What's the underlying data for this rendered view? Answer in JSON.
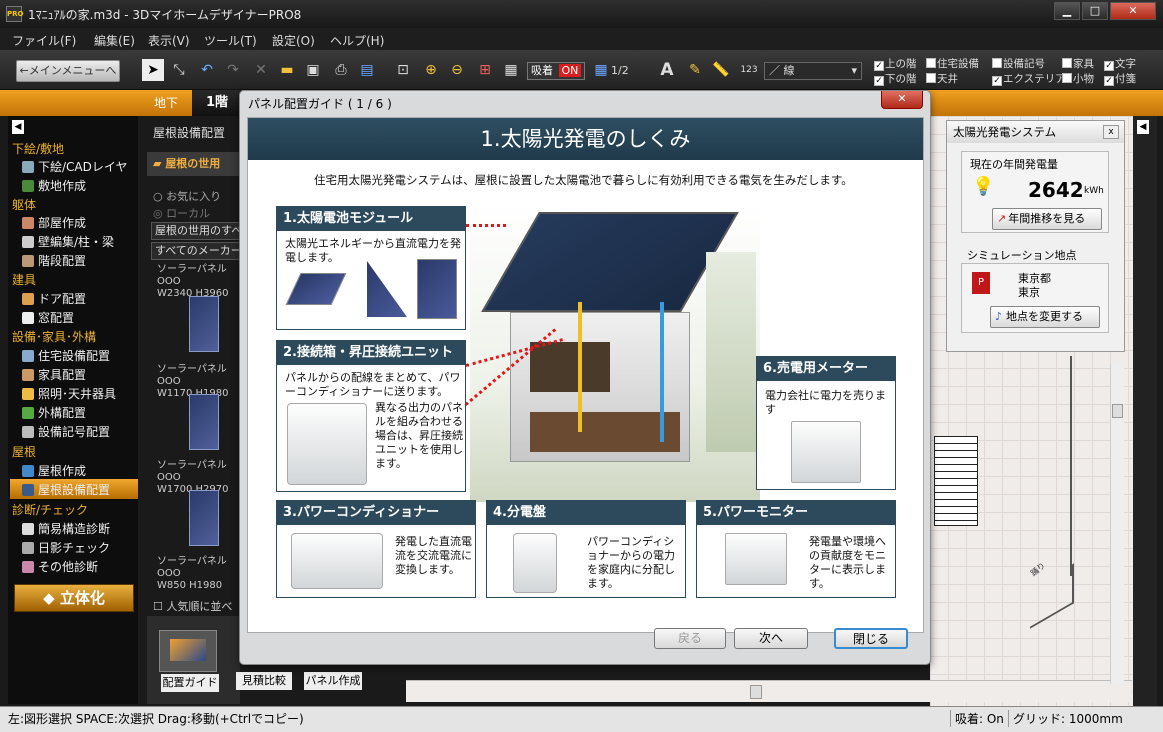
{
  "window": {
    "title": "1ﾏﾆｭｱﾙの家.m3d - 3DマイホームデザイナーPRO8",
    "logo": "PRO"
  },
  "menu": [
    "ファイル(F)",
    "編集(E)",
    "表示(V)",
    "ツール(T)",
    "設定(O)",
    "ヘルプ(H)"
  ],
  "toolbar": {
    "main_menu": "←メインメニューへ",
    "snap_label": "吸着",
    "snap_state": "ON",
    "page": "1/2",
    "line_label": "線",
    "checks": [
      {
        "label": "上の階",
        "on": true
      },
      {
        "label": "住宅設備",
        "on": false
      },
      {
        "label": "設備記号",
        "on": false
      },
      {
        "label": "家具",
        "on": false
      },
      {
        "label": "文字",
        "on": true
      },
      {
        "label": "下の階",
        "on": true
      },
      {
        "label": "天井",
        "on": false
      },
      {
        "label": "エクステリア",
        "on": true
      },
      {
        "label": "小物",
        "on": false
      },
      {
        "label": "付箋",
        "on": true
      }
    ]
  },
  "floor_tabs": [
    "地下",
    "1階"
  ],
  "nav": {
    "sections": [
      {
        "title": "下絵/敷地",
        "items": [
          "下絵/CADレイヤ",
          "敷地作成"
        ]
      },
      {
        "title": "躯体",
        "items": [
          "部屋作成",
          "壁編集/柱・梁",
          "階段配置"
        ]
      },
      {
        "title": "建具",
        "items": [
          "ドア配置",
          "窓配置"
        ]
      },
      {
        "title": "設備･家具･外構",
        "items": [
          "住宅設備配置",
          "家具配置",
          "照明･天井器具",
          "外構配置",
          "設備記号配置"
        ]
      },
      {
        "title": "屋根",
        "items": [
          "屋根作成",
          "屋根設備配置"
        ]
      },
      {
        "title": "診断/チェック",
        "items": [
          "簡易構造診断",
          "日影チェック",
          "その他診断"
        ]
      }
    ],
    "button": "立体化"
  },
  "panel": {
    "title": "屋根設備配置",
    "folder": "屋根の世用",
    "fav": "お気に入り",
    "local": "ローカル",
    "select1": "屋根の世用のすべ",
    "select2": "すべてのメーカー",
    "items": [
      {
        "name": "ソーラーパネルOOO",
        "size": "W2340 H3960"
      },
      {
        "name": "ソーラーパネルOOO",
        "size": "W1170 H1980"
      },
      {
        "name": "ソーラーパネルOOO",
        "size": "W1700 H2970"
      },
      {
        "name": "ソーラーパネルOOO",
        "size": "W850 H1980"
      }
    ],
    "sort": "人気順に並べ",
    "bottom": [
      "配置ガイド",
      "見積比較",
      "パネル作成"
    ]
  },
  "dialog": {
    "title": "パネル配置ガイド ( 1 / 6 )",
    "heading": "1.太陽光発電のしくみ",
    "intro": "住宅用太陽光発電システムは、屋根に設置した太陽電池で暮らしに有効利用できる電気を生みだします。",
    "cards": [
      {
        "title": "1.太陽電池モジュール",
        "text": "太陽光エネルギーから直流電力を発電します。"
      },
      {
        "title": "2.接続箱・昇圧接続ユニット",
        "text": "パネルからの配線をまとめて、パワーコンディショナーに送ります。",
        "text2": "異なる出力のパネルを組み合わせる場合は、昇圧接続ユニットを使用します。"
      },
      {
        "title": "3.パワーコンディショナー",
        "text": "発電した直流電流を交流電流に変換します。"
      },
      {
        "title": "4.分電盤",
        "text": "パワーコンディショナーからの電力を家庭内に分配します。"
      },
      {
        "title": "5.パワーモニター",
        "text": "発電量や環境への貢献度をモニターに表示します。"
      },
      {
        "title": "6.売電用メーター",
        "text": "電力会社に電力を売ります"
      }
    ],
    "buttons": {
      "back": "戻る",
      "next": "次へ",
      "close": "閉じる"
    }
  },
  "solar": {
    "title": "太陽光発電システム",
    "gen_label": "現在の年間発電量",
    "gen_value": "2642",
    "gen_unit": "kWh",
    "trend_btn": "年間推移を見る",
    "site_label": "シミュレーション地点",
    "pref": "東京都",
    "city": "東京",
    "change_btn": "地点を変更する"
  },
  "canvas": {
    "label": "踊り"
  },
  "status": {
    "left": "左:図形選択 SPACE:次選択 Drag:移動(+Ctrlでコピー)",
    "snap": "吸着: On",
    "grid": "グリッド: 1000mm"
  }
}
